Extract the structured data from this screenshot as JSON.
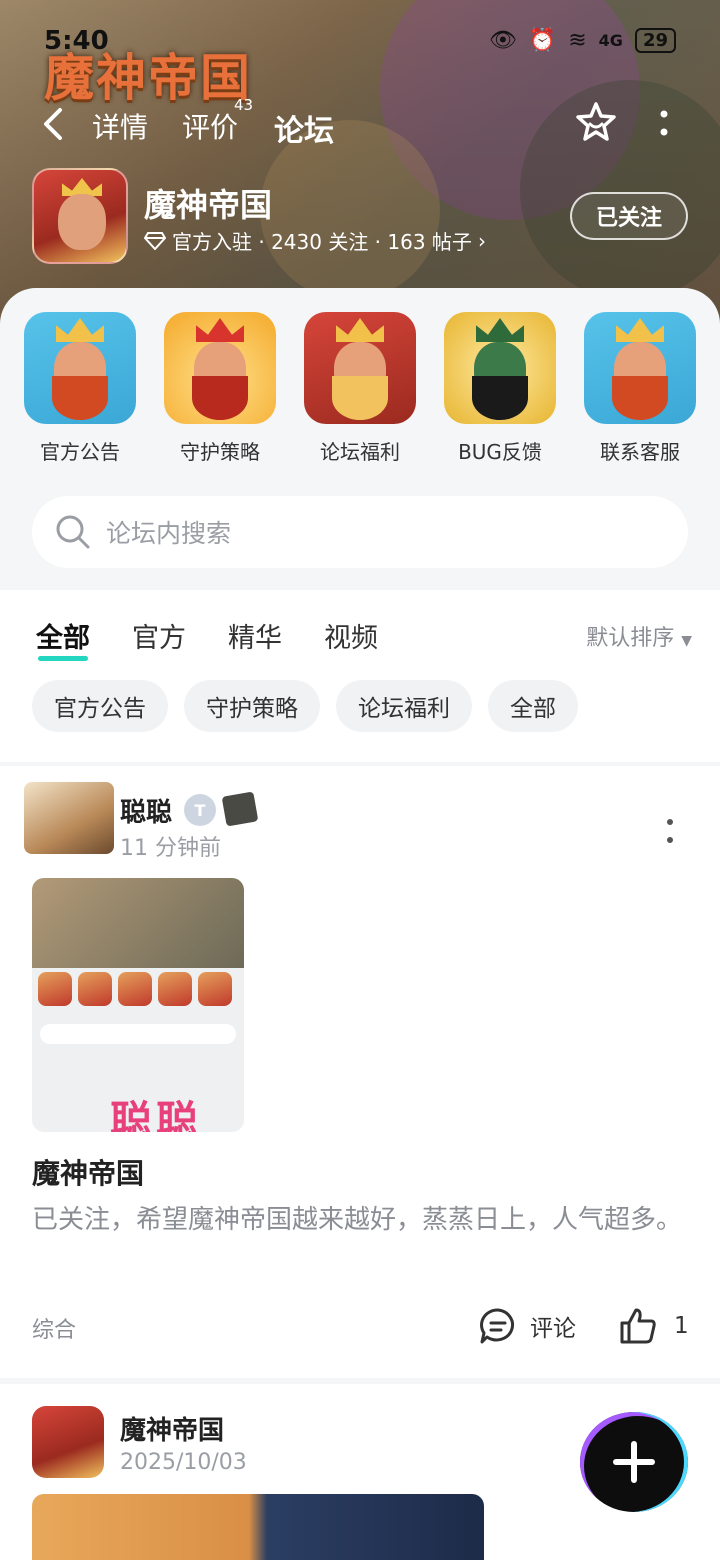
{
  "status": {
    "time": "5:40",
    "battery": "29",
    "network": "4G"
  },
  "header": {
    "game_logo": "魔神帝国",
    "tabs": [
      {
        "label": "详情"
      },
      {
        "label": "评价",
        "count": "43"
      },
      {
        "label": "论坛"
      }
    ]
  },
  "game": {
    "name": "魔神帝国",
    "meta": "官方入驻 · 2430 关注 · 163 帖子",
    "follow_label": "已关注"
  },
  "categories": [
    {
      "label": "官方公告"
    },
    {
      "label": "守护策略"
    },
    {
      "label": "论坛福利"
    },
    {
      "label": "BUG反馈"
    },
    {
      "label": "联系客服"
    }
  ],
  "search": {
    "placeholder": "论坛内搜索"
  },
  "filters": {
    "tabs": [
      "全部",
      "官方",
      "精华",
      "视频"
    ],
    "sort": "默认排序",
    "chips": [
      "官方公告",
      "守护策略",
      "论坛福利",
      "全部"
    ]
  },
  "posts": [
    {
      "author": "聪聪",
      "badge": "T",
      "time": "11 分钟前",
      "image_watermark": "聪聪",
      "title": "魔神帝国",
      "body": "已关注，希望魔神帝国越来越好，蒸蒸日上，人气超多。",
      "tag": "综合",
      "comment_label": "评论",
      "likes": "1"
    },
    {
      "author": "魔神帝国",
      "time": "2025/10/03"
    }
  ],
  "colors": {
    "accent": "#23d6bf",
    "text": "#222222",
    "muted": "#8a8e94"
  }
}
